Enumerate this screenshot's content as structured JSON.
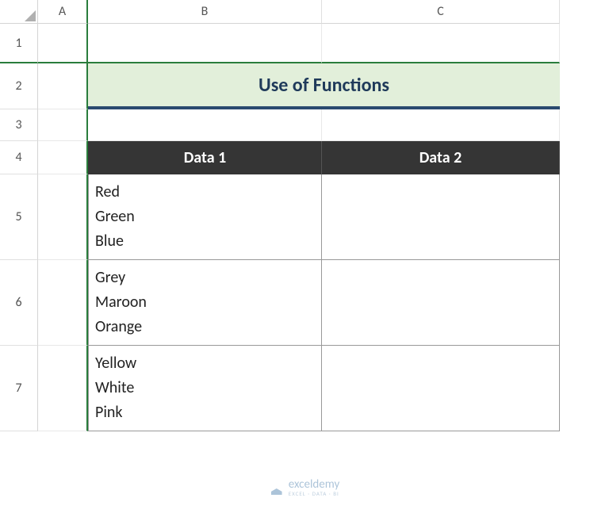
{
  "columns": {
    "corner": "",
    "A": "A",
    "B": "B",
    "C": "C"
  },
  "rows": {
    "r1": "1",
    "r2": "2",
    "r3": "3",
    "r4": "4",
    "r5": "5",
    "r6": "6",
    "r7": "7"
  },
  "title": "Use of Functions",
  "headers": {
    "data1": "Data 1",
    "data2": "Data 2"
  },
  "data": {
    "b5": "Red\nGreen\nBlue",
    "b6": "Grey\nMaroon\nOrange",
    "b7": "Yellow\nWhite\nPink",
    "c5": "",
    "c6": "",
    "c7": ""
  },
  "watermark": {
    "main": "exceldemy",
    "sub": "EXCEL · DATA · BI"
  }
}
